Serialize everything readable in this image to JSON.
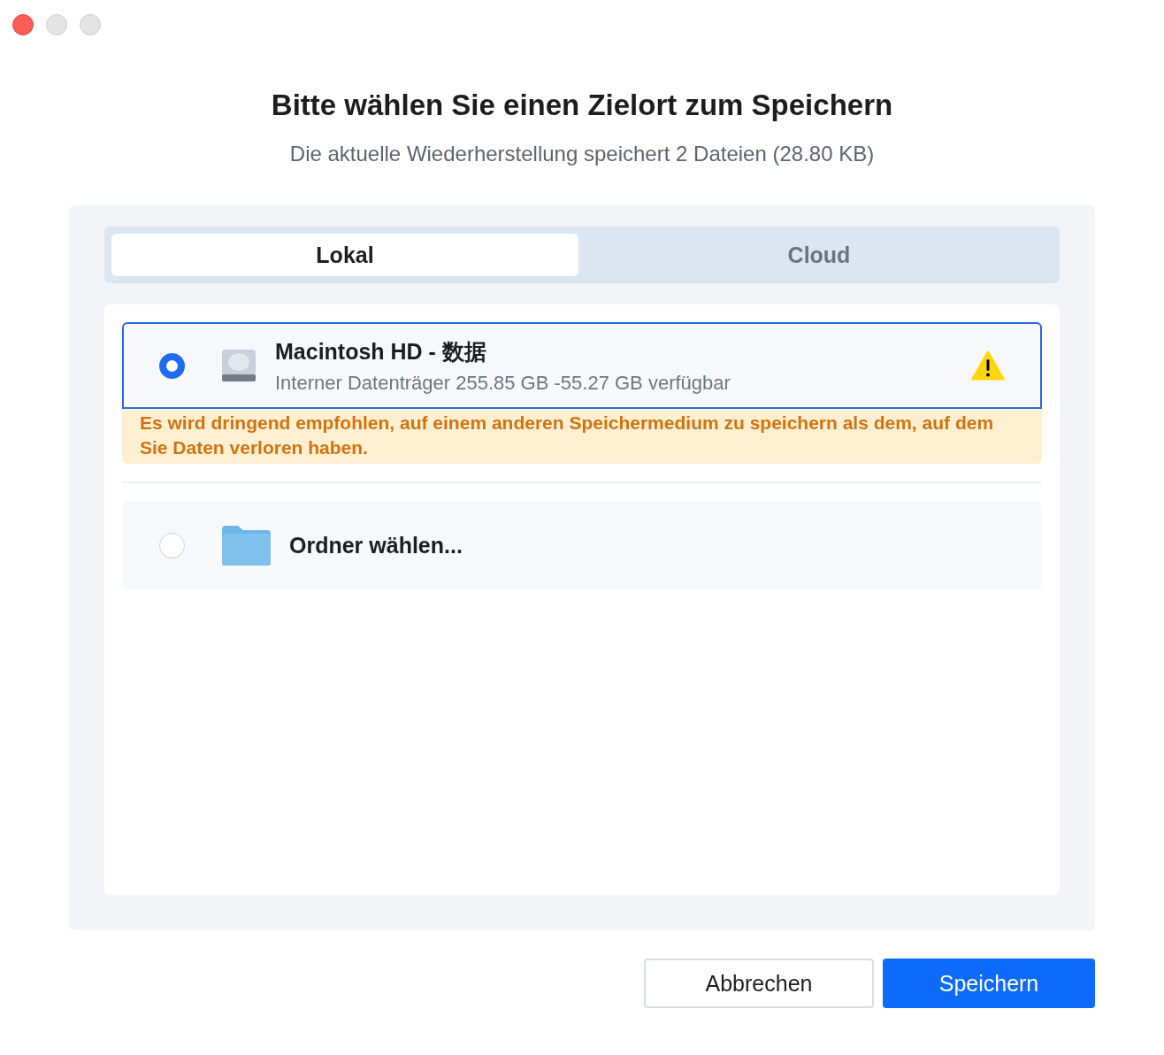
{
  "dialog": {
    "title": "Bitte wählen Sie einen Zielort zum Speichern",
    "subtitle": "Die aktuelle Wiederherstellung speichert 2 Dateien (28.80 KB)"
  },
  "tabs": [
    {
      "label": "Lokal",
      "selected": true
    },
    {
      "label": "Cloud",
      "selected": false
    }
  ],
  "locations": [
    {
      "kind": "disk",
      "name": "Macintosh  HD - 数据",
      "detail": "Interner Datenträger 255.85 GB -55.27 GB verfügbar",
      "selected": true,
      "warning": "Es wird dringend empfohlen, auf einem anderen Speichermedium zu speichern als dem, auf dem Sie Daten verloren haben."
    },
    {
      "kind": "folder",
      "name": "Ordner wählen...",
      "selected": false
    }
  ],
  "buttons": [
    {
      "label": "Abbrechen",
      "kind": "secondary"
    },
    {
      "label": "Speichern",
      "kind": "primary"
    }
  ]
}
